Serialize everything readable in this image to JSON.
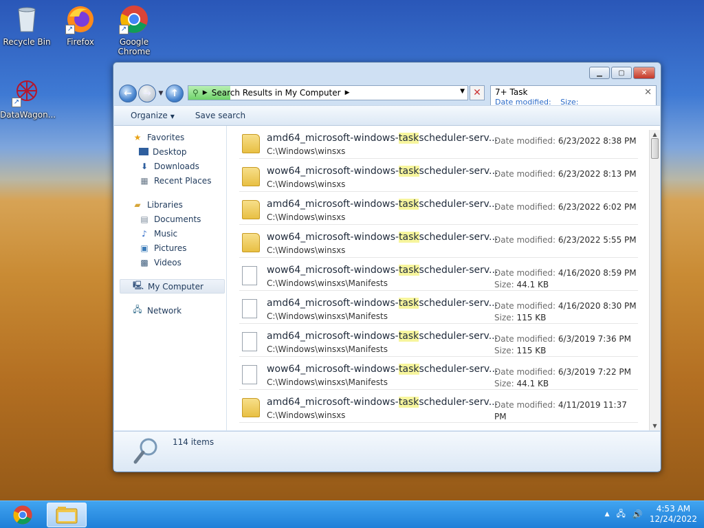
{
  "desktop": {
    "icons": [
      {
        "label": "Recycle Bin",
        "icon": "recycle-bin-icon"
      },
      {
        "label": "Firefox",
        "icon": "firefox-icon"
      },
      {
        "label": "Google Chrome",
        "icon": "chrome-icon"
      },
      {
        "label": "DataWagon...",
        "icon": "datawagon-icon"
      }
    ]
  },
  "window": {
    "address": {
      "text": "Search Results in My Computer",
      "progress": 0.15
    },
    "search": {
      "value": "7+ Task",
      "filter1": "Date modified:",
      "filter2": "Size:"
    },
    "toolbar": {
      "organize": "Organize",
      "save_search": "Save search"
    },
    "sidebar": {
      "favorites": "Favorites",
      "desktop": "Desktop",
      "downloads": "Downloads",
      "recent": "Recent Places",
      "libraries": "Libraries",
      "documents": "Documents",
      "music": "Music",
      "pictures": "Pictures",
      "videos": "Videos",
      "computer": "My Computer",
      "network": "Network"
    },
    "rows": [
      {
        "pre": "amd64_microsoft-windows-",
        "hl": "task",
        "post": "scheduler-serv...",
        "path": "C:\\Windows\\winsxs",
        "date_label": "Date modified:",
        "date": "6/23/2022 8:38 PM",
        "size_label": "",
        "size": "",
        "type": "folder"
      },
      {
        "pre": "wow64_microsoft-windows-",
        "hl": "task",
        "post": "scheduler-serv...",
        "path": "C:\\Windows\\winsxs",
        "date_label": "Date modified:",
        "date": "6/23/2022 8:13 PM",
        "size_label": "",
        "size": "",
        "type": "folder"
      },
      {
        "pre": "amd64_microsoft-windows-",
        "hl": "task",
        "post": "scheduler-serv...",
        "path": "C:\\Windows\\winsxs",
        "date_label": "Date modified:",
        "date": "6/23/2022 6:02 PM",
        "size_label": "",
        "size": "",
        "type": "folder"
      },
      {
        "pre": "wow64_microsoft-windows-",
        "hl": "task",
        "post": "scheduler-serv...",
        "path": "C:\\Windows\\winsxs",
        "date_label": "Date modified:",
        "date": "6/23/2022 5:55 PM",
        "size_label": "",
        "size": "",
        "type": "folder"
      },
      {
        "pre": "wow64_microsoft-windows-",
        "hl": "task",
        "post": "scheduler-serv...",
        "path": "C:\\Windows\\winsxs\\Manifests",
        "date_label": "Date modified:",
        "date": "4/16/2020 8:59 PM",
        "size_label": "Size:",
        "size": "44.1 KB",
        "type": "doc"
      },
      {
        "pre": "amd64_microsoft-windows-",
        "hl": "task",
        "post": "scheduler-serv...",
        "path": "C:\\Windows\\winsxs\\Manifests",
        "date_label": "Date modified:",
        "date": "4/16/2020 8:30 PM",
        "size_label": "Size:",
        "size": "115 KB",
        "type": "doc"
      },
      {
        "pre": "amd64_microsoft-windows-",
        "hl": "task",
        "post": "scheduler-serv...",
        "path": "C:\\Windows\\winsxs\\Manifests",
        "date_label": "Date modified:",
        "date": "6/3/2019 7:36 PM",
        "size_label": "Size:",
        "size": "115 KB",
        "type": "doc"
      },
      {
        "pre": "wow64_microsoft-windows-",
        "hl": "task",
        "post": "scheduler-serv...",
        "path": "C:\\Windows\\winsxs\\Manifests",
        "date_label": "Date modified:",
        "date": "6/3/2019 7:22 PM",
        "size_label": "Size:",
        "size": "44.1 KB",
        "type": "doc"
      },
      {
        "pre": "amd64_microsoft-windows-",
        "hl": "task",
        "post": "scheduler-serv...",
        "path": "C:\\Windows\\winsxs",
        "date_label": "Date modified:",
        "date": "4/11/2019 11:37 PM",
        "size_label": "",
        "size": "",
        "type": "folder"
      }
    ],
    "status": {
      "count": "114 items"
    }
  },
  "taskbar": {
    "clock_time": "4:53 AM",
    "clock_date": "12/24/2022"
  },
  "colors": {
    "taskbar": "#2a8ae0",
    "highlight": "#f7f59d"
  }
}
